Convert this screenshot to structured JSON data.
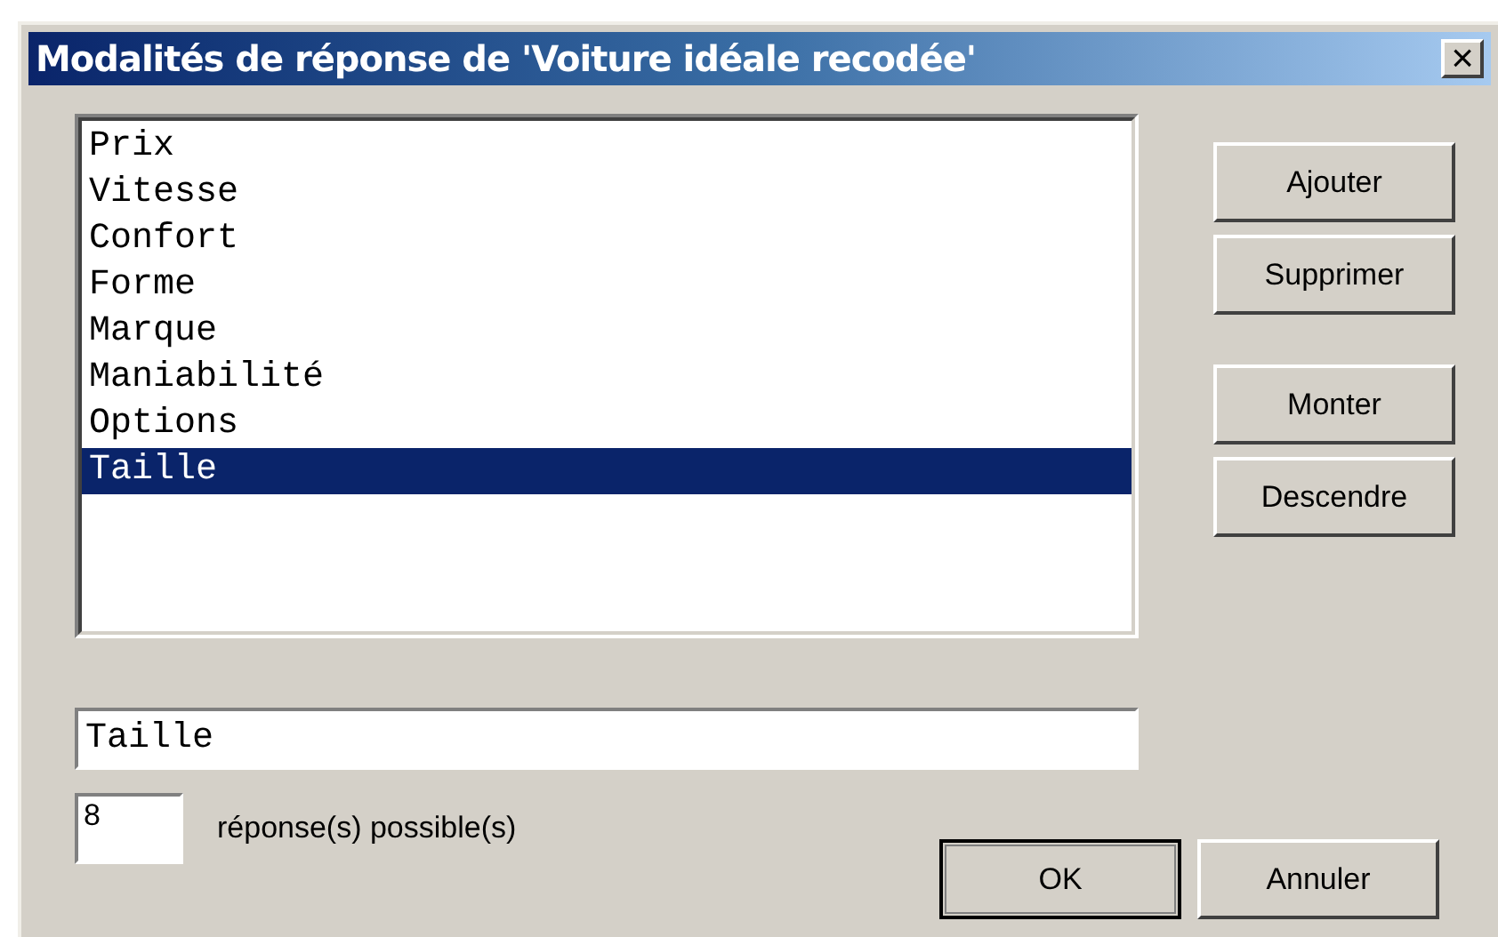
{
  "window": {
    "title": "Modalités de réponse de 'Voiture idéale recodée'",
    "close": "×"
  },
  "list": {
    "items": [
      {
        "label": "Prix",
        "selected": false
      },
      {
        "label": "Vitesse",
        "selected": false
      },
      {
        "label": "Confort",
        "selected": false
      },
      {
        "label": "Forme",
        "selected": false
      },
      {
        "label": "Marque",
        "selected": false
      },
      {
        "label": "Maniabilité",
        "selected": false
      },
      {
        "label": "Options",
        "selected": false
      },
      {
        "label": "Taille",
        "selected": true
      }
    ]
  },
  "side_buttons": [
    "Ajouter",
    "Supprimer",
    "Monter",
    "Descendre"
  ],
  "edit_field": {
    "value": "Taille"
  },
  "count_field": {
    "value": "8"
  },
  "count_label": "réponse(s) possible(s)",
  "buttons": [
    {
      "label": "OK",
      "default": true
    },
    {
      "label": "Annuler",
      "default": false
    }
  ]
}
